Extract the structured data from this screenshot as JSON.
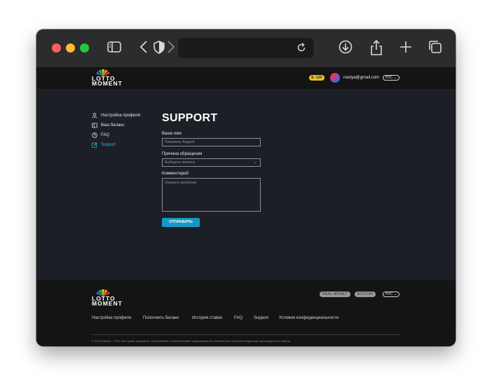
{
  "browser": {
    "url": ""
  },
  "header": {
    "logo_line1": "LOTTO",
    "logo_line2": "MOMENT",
    "balance": "$: 120",
    "email": "nastya@gmail.com",
    "language": "РУС"
  },
  "sidebar": {
    "items": [
      {
        "label": "Настройка профиля",
        "icon": "user-icon",
        "active": false
      },
      {
        "label": "Ваш баланс",
        "icon": "wallet-icon",
        "active": false
      },
      {
        "label": "FAQ",
        "icon": "question-icon",
        "active": false
      },
      {
        "label": "Support",
        "icon": "edit-icon",
        "active": true
      }
    ]
  },
  "main": {
    "title": "SUPPORT",
    "name_label": "Ваше имя",
    "name_placeholder": "Например Андрей",
    "reason_label": "Причина обращения",
    "reason_placeholder": "Выберите причину",
    "comment_label": "Комментарий",
    "comment_placeholder": "Опишите проблему",
    "submit_label": "ОТПРАВИТЬ"
  },
  "footer": {
    "logo_line1": "LOTTO",
    "logo_line2": "MOMENT",
    "pill_real_money": "REAL MONEY",
    "pill_bitcoin": "BITCOIN",
    "language": "РУС",
    "links": [
      "Настройка профиля",
      "Пополнить баланс",
      "История ставок",
      "FAQ",
      "Support",
      "Условия конфиденциальности"
    ],
    "copyright": "© TheOCstudio · 2020. Все права защищены. Копирование и использование информации без письменного согласия владельца преследуется по закону."
  },
  "colors": {
    "accent": "#29b7e4",
    "button": "#1598c4",
    "balance_badge": "#f2c31b",
    "page_bg": "#1c1f26",
    "header_bg": "#141414"
  }
}
